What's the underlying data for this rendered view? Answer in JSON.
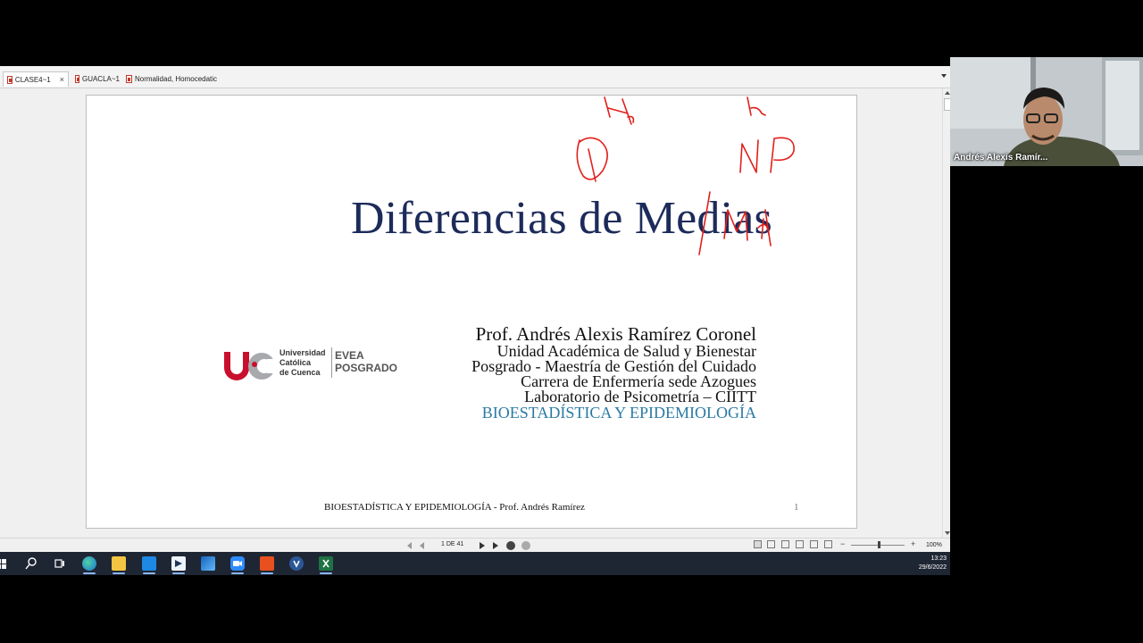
{
  "viewer": {
    "tabs": [
      {
        "label": "CLASE4~1",
        "active": true
      },
      {
        "label": "GUACLA~1",
        "active": false
      },
      {
        "label": "Normalidad, Homocedatic",
        "active": false
      }
    ],
    "close_glyph": "×"
  },
  "slide": {
    "title": "Diferencias de Medias",
    "author": "Prof. Andrés Alexis Ramírez Coronel",
    "affiliations": [
      "Unidad Académica de Salud y Bienestar",
      "Posgrado - Maestría de Gestión del Cuidado",
      "Carrera de Enfermería sede Azogues",
      "Laboratorio de Psicometría – CIITT"
    ],
    "course": "BIOESTADÍSTICA Y EPIDEMIOLOGÍA",
    "footer": "BIOESTADÍSTICA Y EPIDEMIOLOGÍA - Prof. Andrés Ramírez",
    "page_number": "1",
    "logo": {
      "line1": "Universidad",
      "line2": "Católica",
      "line3": "de Cuenca",
      "evea1": "EVEA",
      "evea2": "POSGRADO"
    },
    "annotations": [
      "H",
      "H",
      "P",
      "NP",
      "Md"
    ]
  },
  "statusbar": {
    "page_indicator": "1 DE 41",
    "zoom": "100%",
    "zoom_minus": "−",
    "zoom_plus": "+"
  },
  "taskbar": {
    "time": "13:23",
    "date": "29/6/2022",
    "apps": [
      "windows-icon",
      "search-icon",
      "task-view-icon",
      "edge-icon",
      "file-explorer-icon",
      "mail-icon",
      "app-icon",
      "photos-icon",
      "zoom-icon",
      "pdf-reader-icon",
      "vivaldi-icon",
      "excel-icon"
    ]
  },
  "webcam": {
    "participant_name": "Andrés Alexis Ramír..."
  },
  "colors": {
    "title": "#1c2b5a",
    "course": "#2a7aa5",
    "ink": "#e0201b",
    "taskbar": "#1f2633"
  }
}
